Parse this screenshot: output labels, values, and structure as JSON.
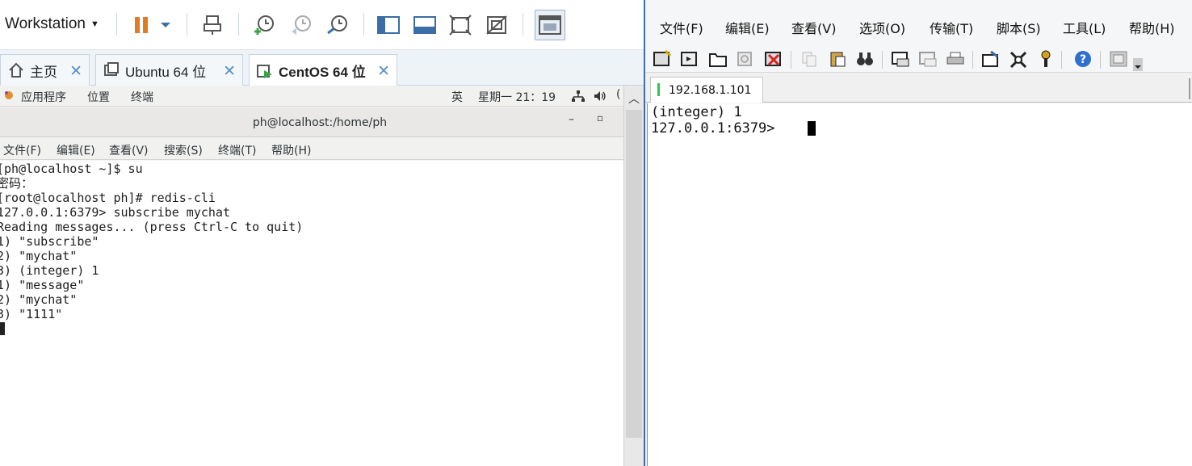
{
  "vmware": {
    "workstation_menu": "Workstation",
    "tabs": [
      {
        "label": "主页"
      },
      {
        "label": "Ubuntu 64 位"
      },
      {
        "label": "CentOS 64 位"
      }
    ],
    "gnome_bar": {
      "applications": "应用程序",
      "places": "位置",
      "terminal": "终端",
      "input_method": "英",
      "clock": "星期一 21：19"
    },
    "terminal": {
      "title": "ph@localhost:/home/ph",
      "menu": [
        "文件(F)",
        "编辑(E)",
        "查看(V)",
        "搜索(S)",
        "终端(T)",
        "帮助(H)"
      ],
      "lines": [
        "[ph@localhost ~]$ su",
        "密码：",
        "[root@localhost ph]# redis-cli",
        "127.0.0.1:6379> subscribe mychat",
        "Reading messages... (press Ctrl-C to quit)",
        "1) \"subscribe\"",
        "2) \"mychat\"",
        "3) (integer) 1",
        "1) \"message\"",
        "2) \"mychat\"",
        "3) \"1111\""
      ]
    }
  },
  "xshell": {
    "menu": [
      "文件(F)",
      "编辑(E)",
      "查看(V)",
      "选项(O)",
      "传输(T)",
      "脚本(S)",
      "工具(L)",
      "帮助(H)"
    ],
    "session_tab": "192.168.1.101",
    "terminal_lines": [
      "(integer) 1",
      "127.0.0.1:6379> "
    ]
  },
  "colors": {
    "vmware_accent": "#3a6ea5",
    "xshell_border": "#3f6ea6",
    "session_active": "#2ec84b"
  }
}
